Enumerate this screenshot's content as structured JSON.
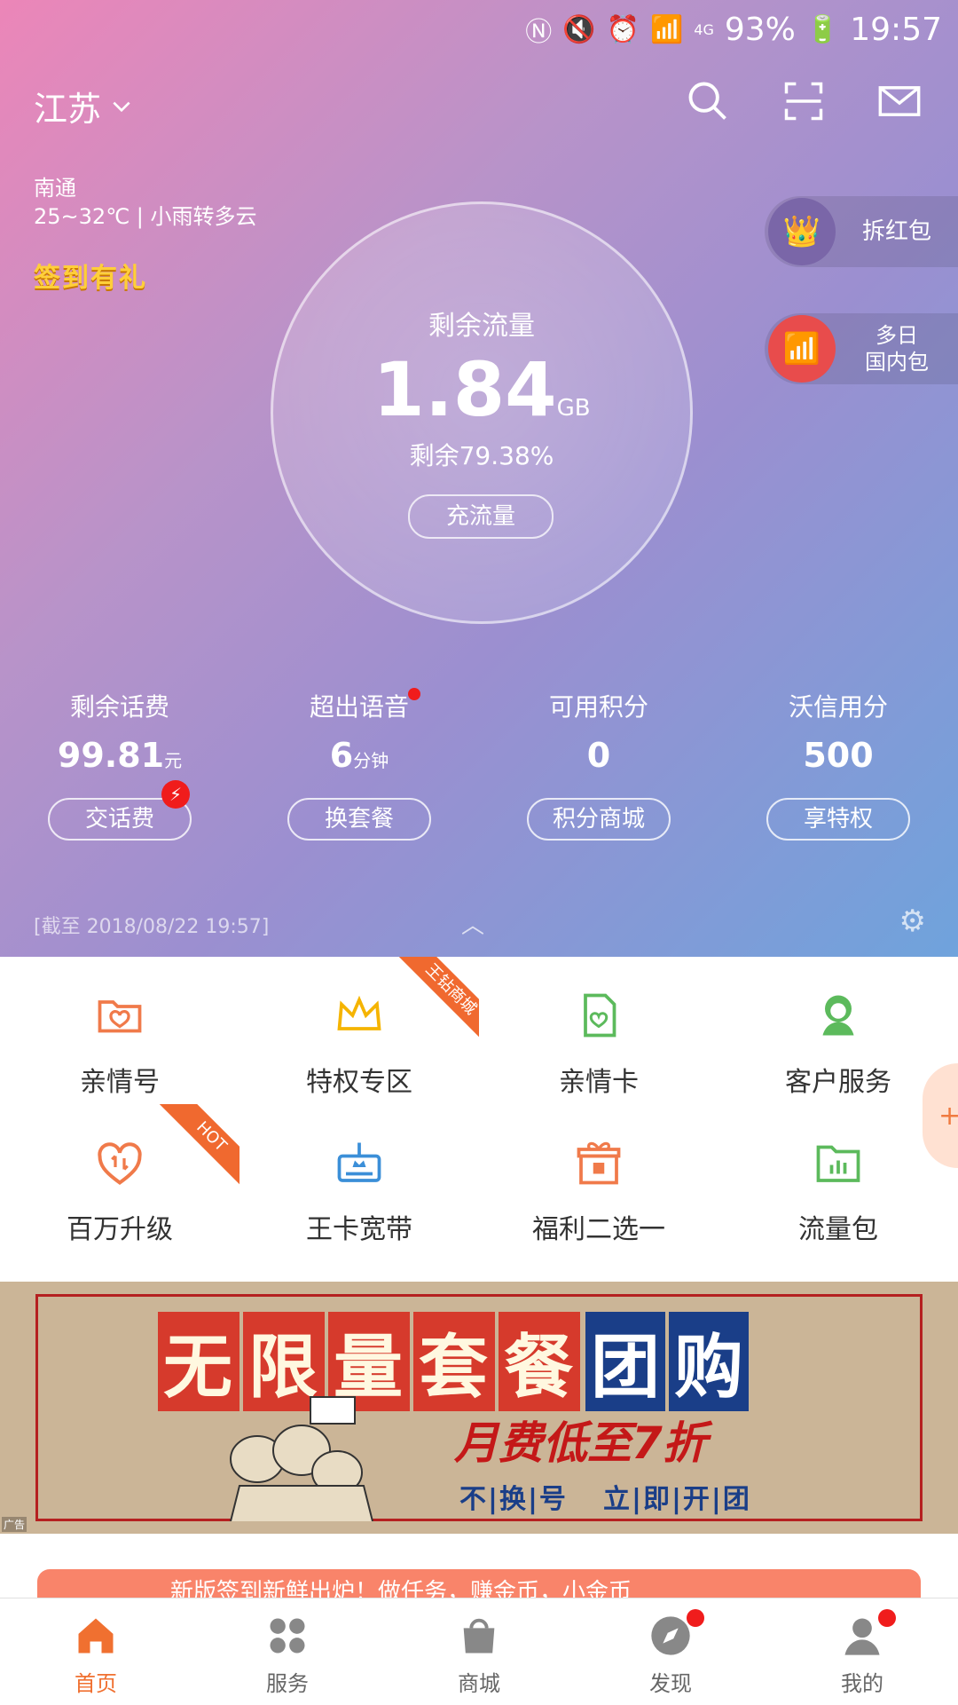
{
  "status_bar": {
    "battery": "93%",
    "time": "19:57",
    "network": "4G"
  },
  "header": {
    "region": "江苏"
  },
  "weather": {
    "city": "南通",
    "forecast": "25~32℃ | 小雨转多云"
  },
  "signin_badge": "签到有礼",
  "data_circle": {
    "label": "剩余流量",
    "value": "1.84",
    "unit": "GB",
    "percent": "剩余79.38%",
    "button": "充流量"
  },
  "side_pills": [
    {
      "label": "拆红包"
    },
    {
      "label_line1": "多日",
      "label_line2": "国内包"
    }
  ],
  "stats": [
    {
      "label": "剩余话费",
      "value": "99.81",
      "unit": "元",
      "button": "交话费"
    },
    {
      "label": "超出语音",
      "value": "6",
      "unit": "分钟",
      "button": "换套餐"
    },
    {
      "label": "可用积分",
      "value": "0",
      "unit": "",
      "button": "积分商城"
    },
    {
      "label": "沃信用分",
      "value": "500",
      "unit": "",
      "button": "享特权"
    }
  ],
  "as_of": "[截至 2018/08/22 19:57]",
  "services": [
    {
      "label": "亲情号",
      "icon": "family-folder-icon"
    },
    {
      "label": "特权专区",
      "icon": "crown-icon",
      "ribbon": "王钻商城"
    },
    {
      "label": "亲情卡",
      "icon": "sim-card-heart-icon"
    },
    {
      "label": "客户服务",
      "icon": "customer-service-icon"
    },
    {
      "label": "百万升级",
      "icon": "heart-upgrade-icon",
      "ribbon": "HOT"
    },
    {
      "label": "王卡宽带",
      "icon": "router-icon"
    },
    {
      "label": "福利二选一",
      "icon": "gift-icon"
    },
    {
      "label": "流量包",
      "icon": "data-folder-icon"
    }
  ],
  "banner": {
    "line1_a": [
      "无",
      "限",
      "量",
      "套",
      "餐"
    ],
    "line1_b": [
      "团",
      "购"
    ],
    "line2": "月费低至7折",
    "line3_a": "不|换|号",
    "line3_b": "立|即|开|团",
    "ad_label": "广告"
  },
  "promo_strip": "新版签到新鲜出炉！做任务，赚金币，小金币",
  "tabs": [
    {
      "label": "首页",
      "active": true
    },
    {
      "label": "服务"
    },
    {
      "label": "商城"
    },
    {
      "label": "发现",
      "dot": true
    },
    {
      "label": "我的",
      "dot": true
    }
  ],
  "colors": {
    "accent": "#f07030",
    "red_dot": "#f01c1c",
    "banner_red": "#c41818",
    "banner_blue": "#1a3e88"
  }
}
